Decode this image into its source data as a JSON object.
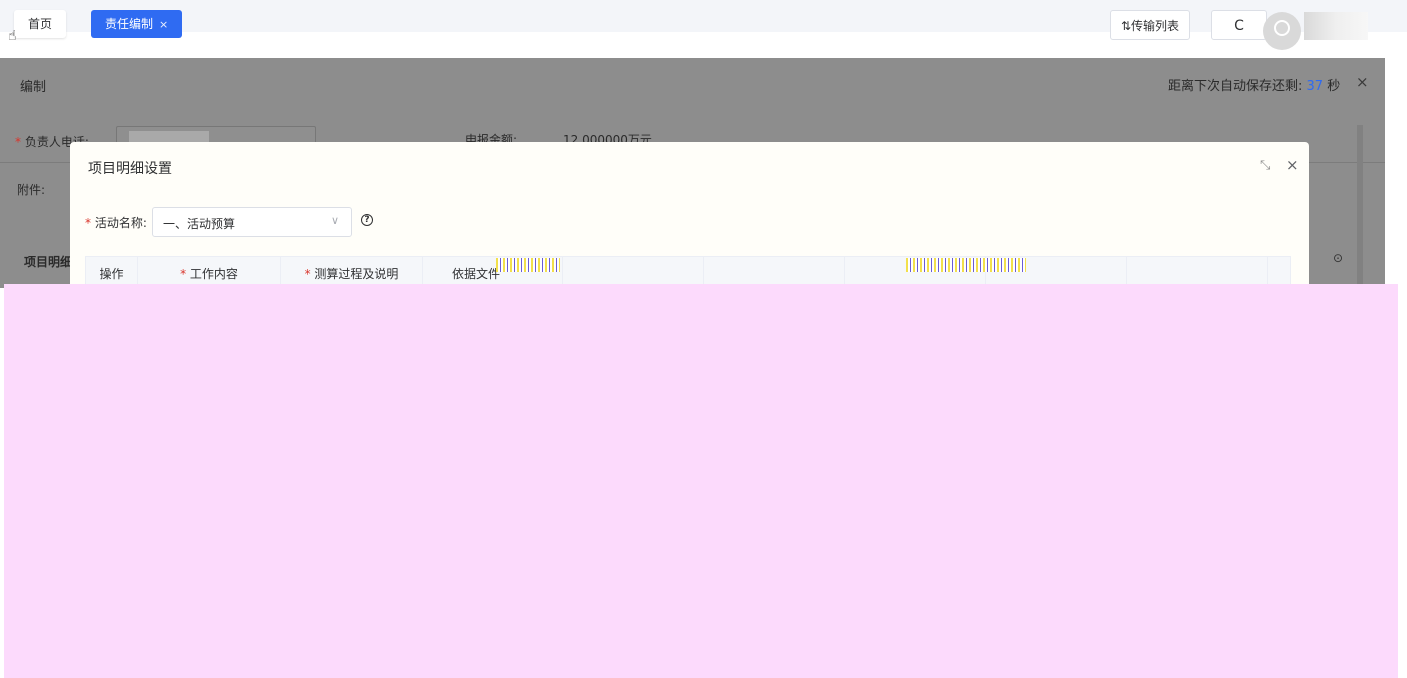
{
  "tabs": {
    "home": "首页",
    "active": "责任编制",
    "active_close": "×"
  },
  "header": {
    "transfer_list": "⇅传输列表",
    "refresh": "C"
  },
  "page": {
    "title": "编制",
    "autosave_prefix": "距离下次自动保存还剩:",
    "autosave_seconds": "37",
    "autosave_unit": "秒",
    "close": "×"
  },
  "background_form": {
    "leader_phone_label": "负责人电话:",
    "amount_label": "申报金额:",
    "amount_value": "12.000000万元",
    "attachment_label": "附件:",
    "section_title": "项目明细"
  },
  "dialog": {
    "title": "项目明细设置",
    "expand": "⤡",
    "close": "×",
    "activity_label": "活动名称:",
    "activity_value": "一、活动预算",
    "help": "?",
    "columns": [
      "操作",
      "工作内容",
      "测算过程及说明",
      "依据文件"
    ],
    "required_columns": [
      false,
      true,
      true,
      false
    ]
  },
  "colors": {
    "accent": "#2f6bf2",
    "required": "#d9342b",
    "overlay": "#8d8d8d",
    "corrupted_region": "#fcdafc"
  }
}
